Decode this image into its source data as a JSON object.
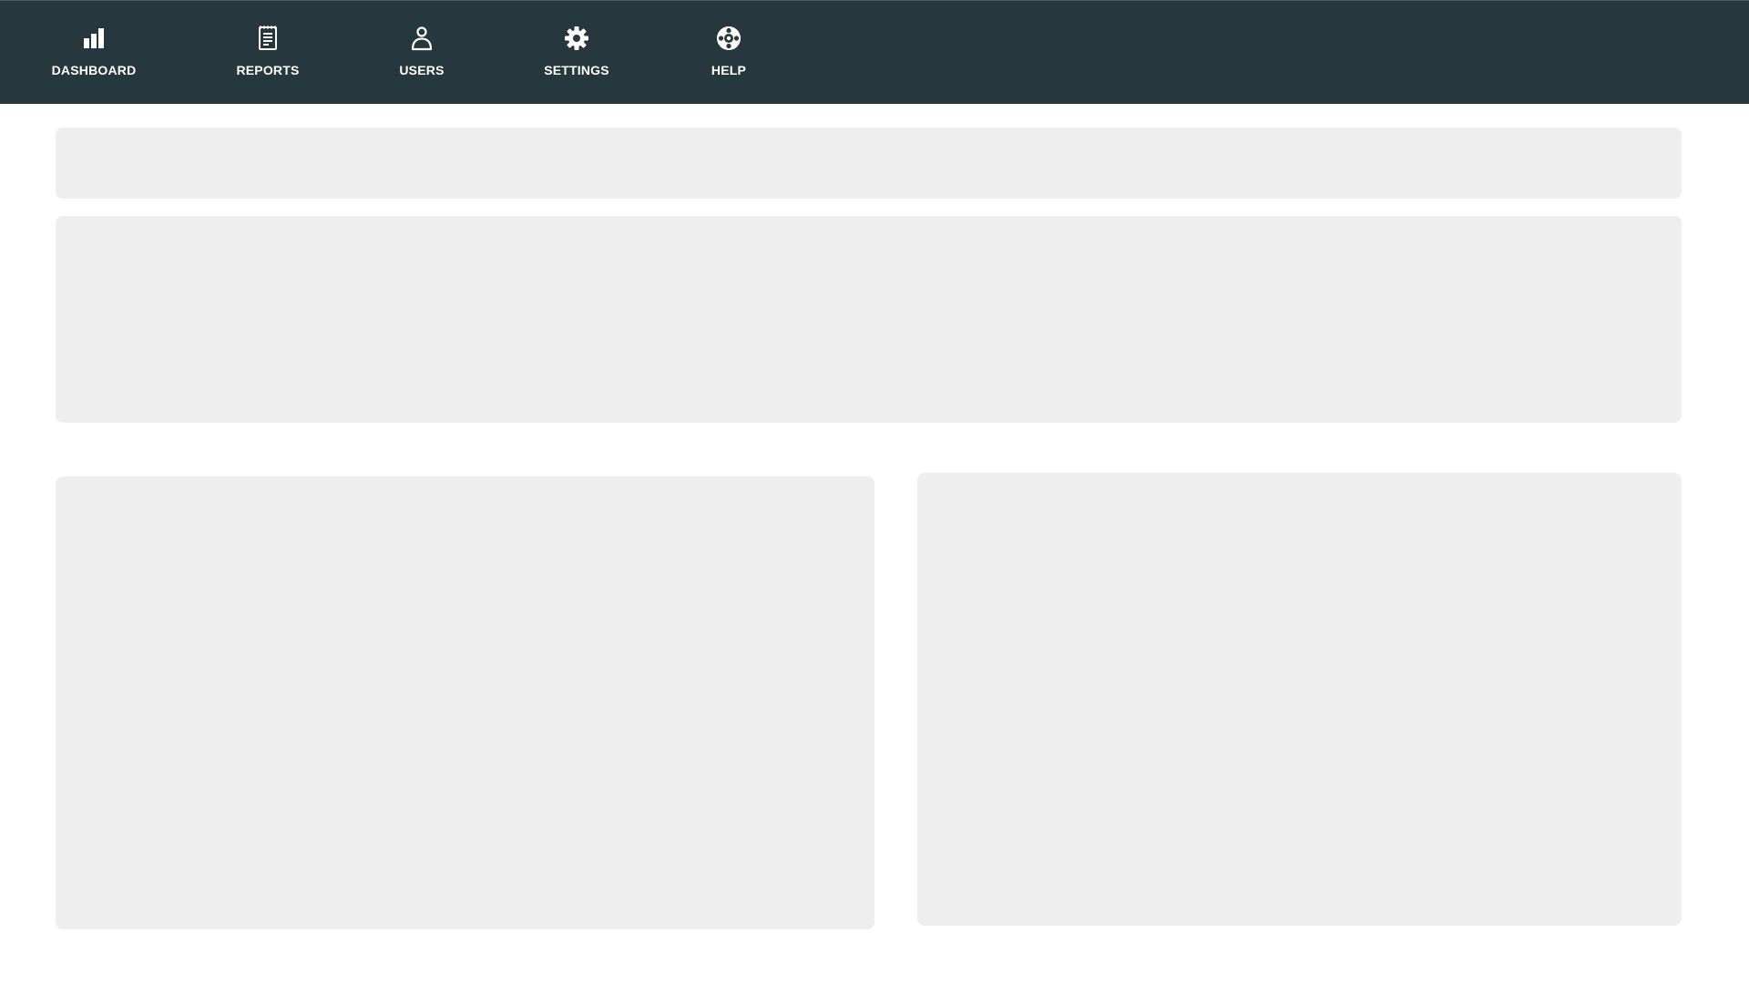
{
  "nav": {
    "items": [
      {
        "id": "dashboard",
        "label": "DASHBOARD",
        "icon": "bar-chart-icon"
      },
      {
        "id": "reports",
        "label": "REPORTS",
        "icon": "report-document-icon"
      },
      {
        "id": "users",
        "label": "USERS",
        "icon": "user-icon"
      },
      {
        "id": "settings",
        "label": "SETTINGS",
        "icon": "gear-icon"
      },
      {
        "id": "help",
        "label": "HELP",
        "icon": "lifebuoy-icon"
      }
    ],
    "background_color": "#26373d",
    "text_color": "#ffffff"
  },
  "content": {
    "panel_color": "#eeeeee"
  }
}
